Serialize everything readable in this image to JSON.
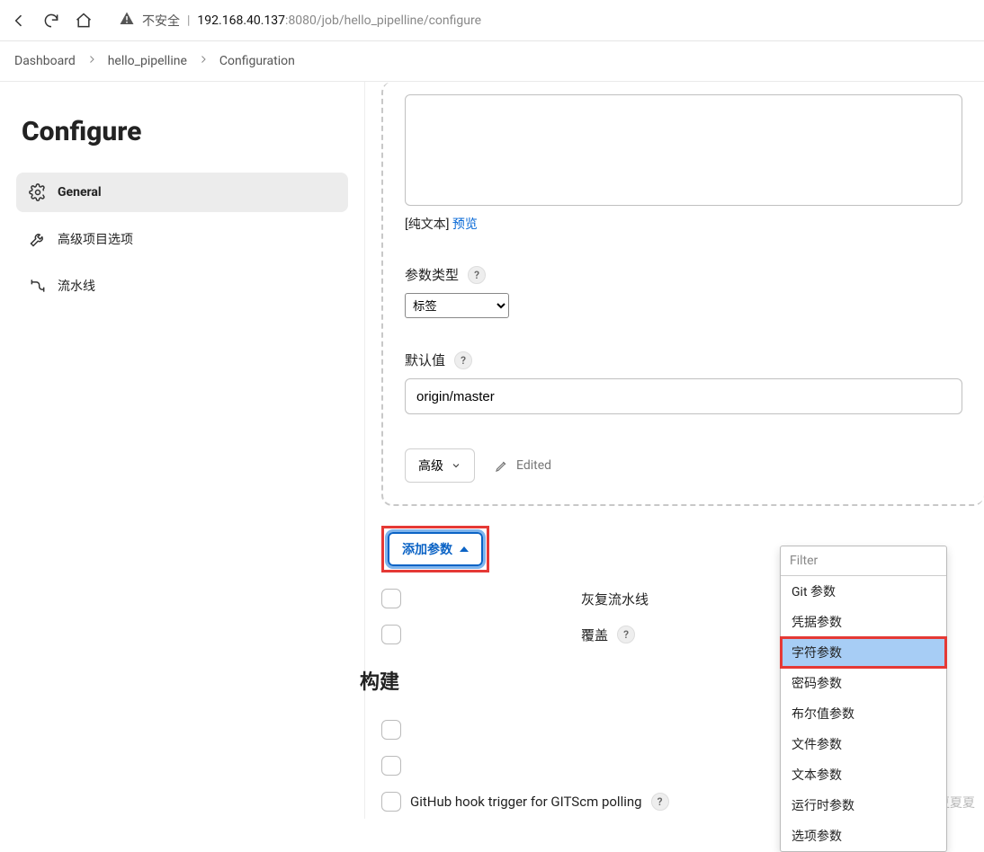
{
  "browser": {
    "insecure_label": "不安全",
    "url_ip": "192.168.40.137",
    "url_rest": ":8080/job/hello_pipelline/configure"
  },
  "breadcrumbs": {
    "items": [
      "Dashboard",
      "hello_pipelline",
      "Configuration"
    ]
  },
  "page": {
    "title": "Configure"
  },
  "sidebar": {
    "items": [
      {
        "label": "General"
      },
      {
        "label": "高级项目选项"
      },
      {
        "label": "流水线"
      }
    ]
  },
  "form": {
    "plain_text_label": "[纯文本]",
    "preview_link": "预览",
    "param_type_label": "参数类型",
    "param_type_value": "标签",
    "default_label": "默认值",
    "default_value": "origin/master",
    "advanced_label": "高级",
    "edited_label": "Edited",
    "add_param_label": "添加参数"
  },
  "dropdown": {
    "filter_placeholder": "Filter",
    "options": [
      "Git 参数",
      "凭据参数",
      "字符参数",
      "密码参数",
      "布尔值参数",
      "文件参数",
      "文本参数",
      "运行时参数",
      "选项参数"
    ],
    "selected_index": 2
  },
  "checks": {
    "row1_suffix": "灰复流水线",
    "row2_suffix": "覆盖",
    "section_title": "构建",
    "row4_label": "GitHub hook trigger for GITScm polling"
  },
  "watermark": "CSDN @生夏夏夏"
}
